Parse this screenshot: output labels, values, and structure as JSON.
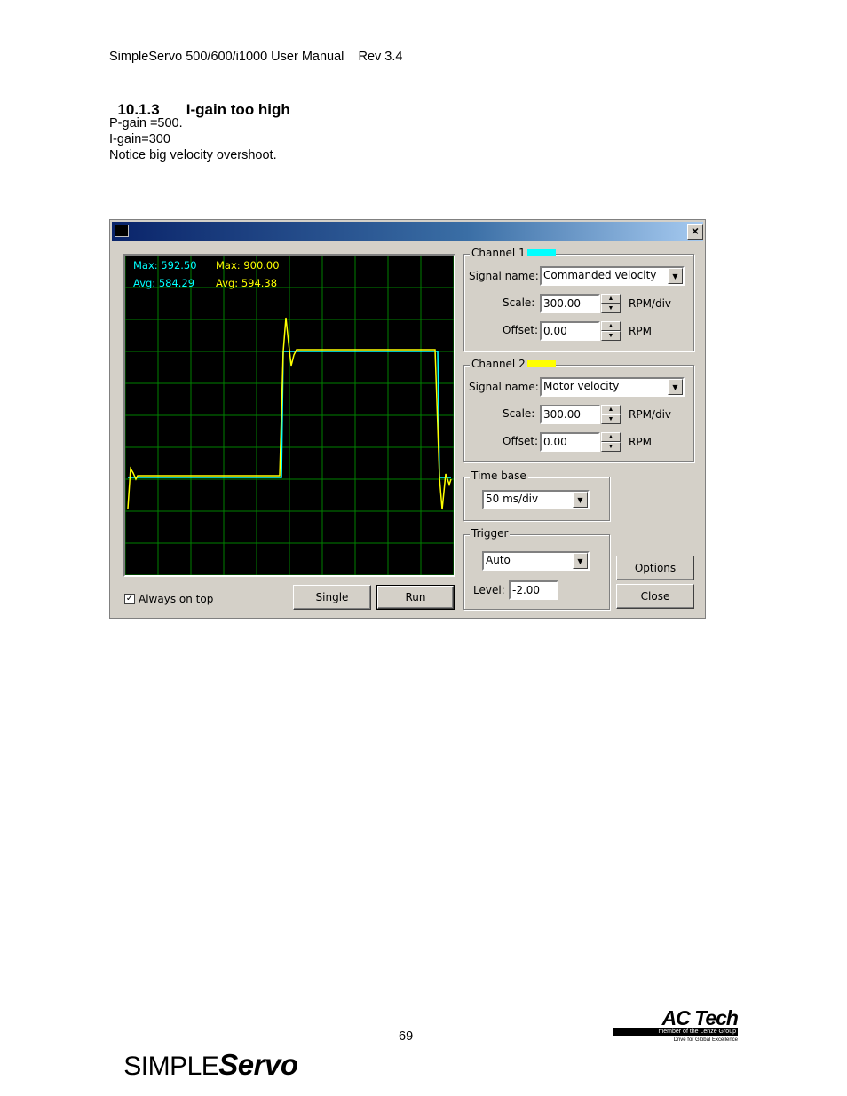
{
  "header": {
    "text": "SimpleServo 500/600/i1000 User Manual    Rev 3.4"
  },
  "section": {
    "number": "10.1.3",
    "title": "I-gain too high"
  },
  "body_lines": [
    "P-gain =500.",
    "I-gain=300",
    "Notice big velocity overshoot."
  ],
  "scope": {
    "ch1_max": "Max: 592.50",
    "ch1_avg": "Avg: 584.29",
    "ch2_max": "Max: 900.00",
    "ch2_avg": "Avg: 594.38",
    "ch1_color": "#00ffff",
    "ch2_color": "#ffff00",
    "grid_color": "#008000"
  },
  "channel1": {
    "label": "Channel 1",
    "signal_label": "Signal name:",
    "signal_value": "Commanded velocity",
    "scale_label": "Scale:",
    "scale_value": "300.00",
    "scale_unit": "RPM/div",
    "offset_label": "Offset:",
    "offset_value": "0.00",
    "offset_unit": "RPM"
  },
  "channel2": {
    "label": "Channel 2",
    "signal_label": "Signal name:",
    "signal_value": "Motor velocity",
    "scale_label": "Scale:",
    "scale_value": "300.00",
    "scale_unit": "RPM/div",
    "offset_label": "Offset:",
    "offset_value": "0.00",
    "offset_unit": "RPM"
  },
  "timebase": {
    "label": "Time base",
    "value": "50 ms/div"
  },
  "trigger": {
    "label": "Trigger",
    "mode": "Auto",
    "level_label": "Level:",
    "level_value": "-2.00"
  },
  "buttons": {
    "options": "Options",
    "close": "Close",
    "single": "Single",
    "run": "Run"
  },
  "always_on_top": {
    "label": "Always on top",
    "checked": true
  },
  "footer": {
    "page_number": "69",
    "logo_simple": "SIMPLE",
    "logo_servo": "Servo",
    "actech_name": "AC Tech",
    "actech_member": "member of the Lenze Group",
    "actech_tagline": "Drive for Global Excellence"
  }
}
